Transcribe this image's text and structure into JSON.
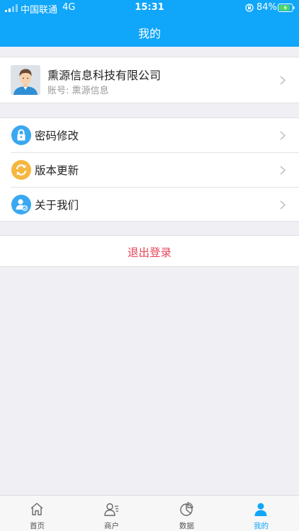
{
  "status_bar": {
    "carrier": "中国联通",
    "network": "4G",
    "time": "15:31",
    "battery_percent": "84%",
    "battery_level": 0.84
  },
  "header": {
    "title": "我的"
  },
  "profile": {
    "company_name": "熏源信息科技有限公司",
    "account_label": "账号: 熏源信息"
  },
  "menu": {
    "items": [
      {
        "label": "密码修改",
        "icon": "lock-icon",
        "color": "#3aa8f0"
      },
      {
        "label": "版本更新",
        "icon": "refresh-icon",
        "color": "#f5b740"
      },
      {
        "label": "关于我们",
        "icon": "about-user-icon",
        "color": "#3aa8f0"
      }
    ]
  },
  "logout": {
    "label": "退出登录",
    "color": "#e8435a"
  },
  "tabbar": {
    "tabs": [
      {
        "label": "首页",
        "icon": "home-icon"
      },
      {
        "label": "商户",
        "icon": "merchant-icon"
      },
      {
        "label": "数据",
        "icon": "pie-chart-icon"
      },
      {
        "label": "我的",
        "icon": "person-icon",
        "active": true
      }
    ]
  },
  "colors": {
    "primary": "#10a6f9",
    "background": "#efeff4",
    "inactive_tab": "#555555"
  }
}
